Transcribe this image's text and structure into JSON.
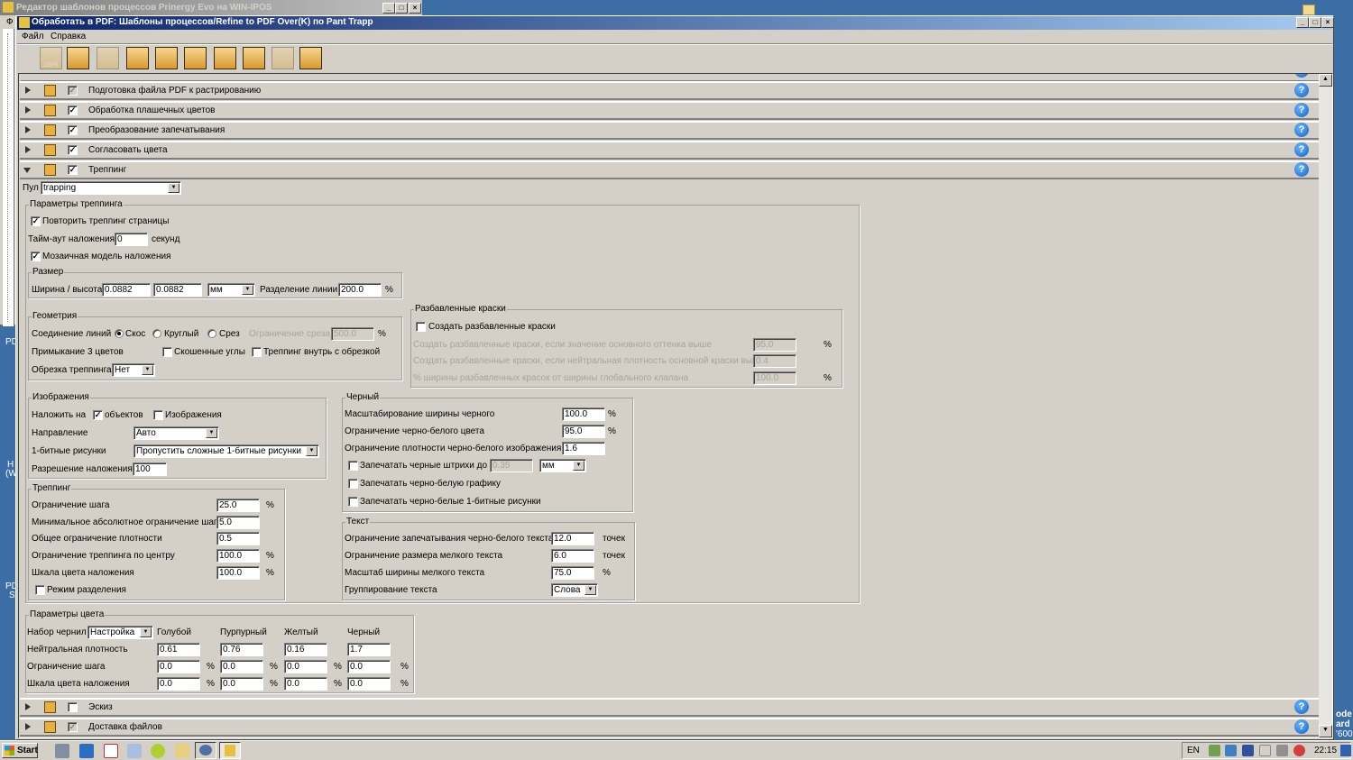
{
  "bg_window": {
    "title": "Редактор шаблонов процессов Prinergy Evo на WIN-IPOS",
    "menu_letter": "Ф"
  },
  "window": {
    "title": "Обработать в PDF: Шаблоны процессов/Refine to PDF Over(K) по Pant Trapp",
    "minimize": "_",
    "maximize": "□",
    "close": "×"
  },
  "menu": [
    "Файл",
    "Справка"
  ],
  "toolbar": [
    {
      "name": "ceps-icon",
      "label": "CEPS",
      "enabled": false
    },
    {
      "name": "pdf-normalize-icon",
      "enabled": true
    },
    {
      "name": "target-icon",
      "enabled": false
    },
    {
      "name": "preflight-icon",
      "enabled": true
    },
    {
      "name": "spot-colors-icon",
      "enabled": true
    },
    {
      "name": "overprint-icon",
      "enabled": true
    },
    {
      "name": "color-match-icon",
      "enabled": true
    },
    {
      "name": "trapping-icon",
      "enabled": true
    },
    {
      "name": "proof-icon",
      "enabled": false
    },
    {
      "name": "delivery-icon",
      "enabled": true
    }
  ],
  "sections": [
    {
      "label": "Подготовка файла PDF к растрированию",
      "checked": true,
      "grayed": true,
      "expanded": false
    },
    {
      "label": "Обработка плашечных цветов",
      "checked": true,
      "grayed": false,
      "expanded": false
    },
    {
      "label": "Преобразование запечатывания",
      "checked": true,
      "grayed": false,
      "expanded": false
    },
    {
      "label": "Согласовать цвета",
      "checked": true,
      "grayed": false,
      "expanded": false
    },
    {
      "label": "Треппинг",
      "checked": true,
      "grayed": false,
      "expanded": true
    },
    {
      "label": "Эскиз",
      "checked": false,
      "grayed": false,
      "expanded": false
    },
    {
      "label": "Доставка файлов",
      "checked": true,
      "grayed": true,
      "expanded": false
    }
  ],
  "help_label": "?",
  "pool": {
    "label": "Пул",
    "value": "trapping"
  },
  "trap": {
    "title": "Параметры треппинга",
    "repeat": "Повторить треппинг страницы",
    "timeout_label": "Тайм-аут наложения",
    "timeout_value": "0",
    "timeout_unit": "секунд",
    "mosaic": "Мозаичная модель наложения",
    "size": {
      "title": "Размер",
      "wh_label": "Ширина / высота",
      "width": "0.0882",
      "height": "0.0882",
      "unit": "мм",
      "split_label": "Разделение линии",
      "split_value": "200.0",
      "pct": "%"
    },
    "geom": {
      "title": "Геометрия",
      "join_label": "Соединение линий",
      "miter": "Скос",
      "round": "Круглый",
      "bevel": "Срез",
      "cut_label": "Ограничение среза",
      "cut_value": "500.0",
      "pct": "%",
      "three_label": "Примыкание 3 цветов",
      "beveled": "Скошенные углы",
      "inside": "Треппинг внутрь с обрезкой",
      "clip_label": "Обрезка треппинга",
      "clip_value": "Нет"
    },
    "dilute": {
      "title": "Разбавленные краски",
      "create": "Создать разбавленные краски",
      "r1": "Создать разбавленные краски, если значение основного оттенка выше",
      "v1": "95.0",
      "r2": "Создать разбавленные краски, если нейтральная плотность основной краски выше",
      "v2": "0.4",
      "r3": "% ширины разбавленных красок от ширины глобального клапана",
      "v3": "100.0",
      "pct": "%"
    },
    "images": {
      "title": "Изображения",
      "apply_label": "Наложить на",
      "objects": "объектов",
      "images": "Изображения",
      "dir_label": "Направление",
      "dir_value": "Авто",
      "bit_label": "1-битные рисунки",
      "bit_value": "Пропустить сложные 1-битные рисунки",
      "res_label": "Разрешение наложения",
      "res_value": "100"
    },
    "trapping": {
      "title": "Треппинг",
      "rows": [
        {
          "label": "Ограничение шага",
          "value": "25.0",
          "unit": "%"
        },
        {
          "label": "Минимальное абсолютное ограничение шага",
          "value": "5.0",
          "unit": ""
        },
        {
          "label": "Общее ограничение плотности",
          "value": "0.5",
          "unit": ""
        },
        {
          "label": "Ограничение треппинга по центру",
          "value": "100.0",
          "unit": "%"
        },
        {
          "label": "Шкала цвета наложения",
          "value": "100.0",
          "unit": "%"
        }
      ],
      "sep": "Режим разделения"
    },
    "black": {
      "title": "Черный",
      "rows": [
        {
          "label": "Масштабирование ширины черного",
          "value": "100.0",
          "unit": "%"
        },
        {
          "label": "Ограничение черно-белого цвета",
          "value": "95.0",
          "unit": "%"
        },
        {
          "label": "Ограничение плотности черно-белого изображения",
          "value": "1.6",
          "unit": ""
        }
      ],
      "strokes": "Запечатать черные штрихи до",
      "strokes_value": "0.35",
      "strokes_unit": "мм",
      "graphics": "Запечатать черно-белую графику",
      "bitmaps": "Запечатать черно-белые 1-битные рисунки"
    },
    "text": {
      "title": "Текст",
      "rows": [
        {
          "label": "Ограничение запечатывания черно-белого текста",
          "value": "12.0",
          "unit": "точек"
        },
        {
          "label": "Ограничение размера мелкого текста",
          "value": "6.0",
          "unit": "точек"
        },
        {
          "label": "Масштаб ширины мелкого текста",
          "value": "75.0",
          "unit": "%"
        }
      ],
      "group_label": "Группирование текста",
      "group_value": "Слова"
    },
    "color": {
      "title": "Параметры цвета",
      "ink_label": "Набор чернил",
      "ink_value": "Настройка",
      "cols": [
        "Голубой",
        "Пурпурный",
        "Желтый",
        "Черный"
      ],
      "rows": [
        {
          "label": "Нейтральная плотность",
          "values": [
            "0.61",
            "0.76",
            "0.16",
            "1.7"
          ],
          "unit": ""
        },
        {
          "label": "Ограничение шага",
          "values": [
            "0.0",
            "0.0",
            "0.0",
            "0.0"
          ],
          "unit": "%"
        },
        {
          "label": "Шкала цвета наложения",
          "values": [
            "0.0",
            "0.0",
            "0.0",
            "0.0"
          ],
          "unit": "%"
        }
      ]
    }
  },
  "desktop_labels": [
    "PD",
    "H",
    "(W",
    "PD",
    "S",
    "ode",
    "ard",
    "'600"
  ],
  "taskbar": {
    "start": "Start",
    "lang": "EN",
    "clock": "22:15"
  },
  "colors": {
    "desktop": "#3a6ea5",
    "face": "#d4d0c8",
    "title_active": "#0a246a",
    "title_inactive": "#808080"
  }
}
